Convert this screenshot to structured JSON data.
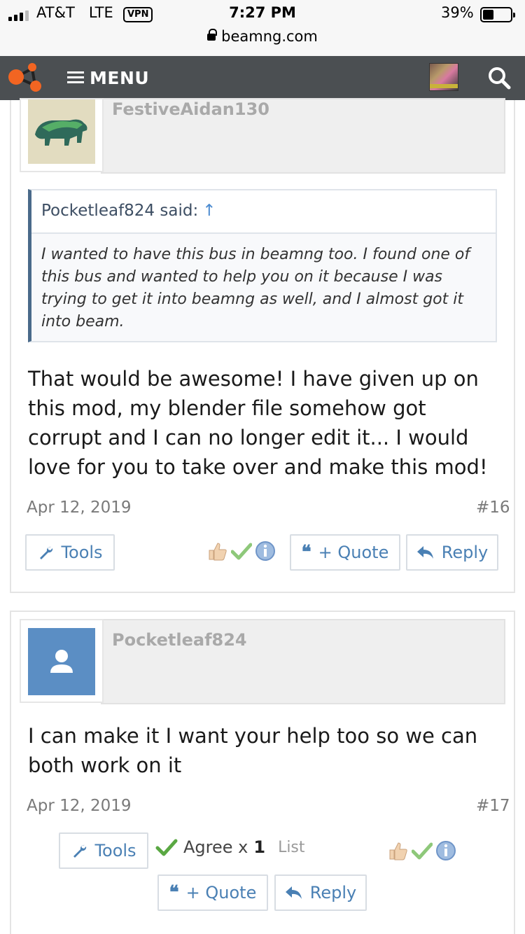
{
  "status_bar": {
    "carrier": "AT&T",
    "network": "LTE",
    "vpn": "VPN",
    "time": "7:27 PM",
    "battery_pct": "39%",
    "battery_level": 0.39,
    "url": "beamng.com"
  },
  "navbar": {
    "menu_label": "MENU",
    "logo_color": "#f26522",
    "bg_color": "#4b4f52"
  },
  "posts": [
    {
      "username": "FestiveAidan130",
      "quote": {
        "author": "Pocketleaf824 said:",
        "arrow": "↑",
        "text": "I wanted to have this bus in beamng too. I found one of this bus and wanted to help you on it because I was trying to get it into beamng as well, and I almost got it into beam."
      },
      "message": "That would be awesome! I have given up on this mod, my blender file somehow got corrupt and I can no longer edit it... I would love for you to take over and make this mod!",
      "date": "Apr 12, 2019",
      "number": "#16",
      "tools_label": "Tools",
      "quote_label": "+ Quote",
      "reply_label": "Reply"
    },
    {
      "username": "Pocketleaf824",
      "message": "I can make it I want your help too so we can both work on it",
      "date": "Apr 12, 2019",
      "number": "#17",
      "tools_label": "Tools",
      "agree_label": "Agree x",
      "agree_count": "1",
      "list_label": "List",
      "quote_label": "+ Quote",
      "reply_label": "Reply"
    }
  ],
  "colors": {
    "accent_blue": "#4a80b4",
    "default_avatar": "#5b8ec4",
    "agree_green": "#5aa843"
  }
}
